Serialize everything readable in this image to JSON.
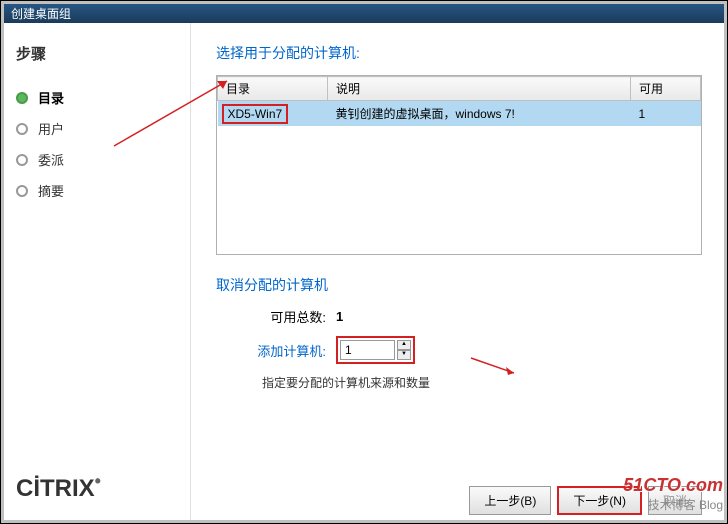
{
  "titlebar": "创建桌面组",
  "sidebar": {
    "title": "步骤",
    "steps": [
      "目录",
      "用户",
      "委派",
      "摘要"
    ]
  },
  "content": {
    "select_title": "选择用于分配的计算机:",
    "table": {
      "headers": {
        "catalog": "目录",
        "desc": "说明",
        "avail": "可用"
      },
      "rows": [
        {
          "catalog": "XD5-Win7",
          "desc": "黄钊创建的虚拟桌面，windows 7!",
          "avail": "1"
        }
      ]
    },
    "cancel_title": "取消分配的计算机",
    "total_label": "可用总数:",
    "total_value": "1",
    "add_label": "添加计算机:",
    "add_value": "1",
    "hint": "指定要分配的计算机来源和数量"
  },
  "buttons": {
    "back": "上一步(B)",
    "next": "下一步(N)",
    "cancel": "取消"
  },
  "logo": "CİTRIX",
  "watermark": {
    "site": "51CTO.com",
    "tag": "技术博客 Blog"
  }
}
